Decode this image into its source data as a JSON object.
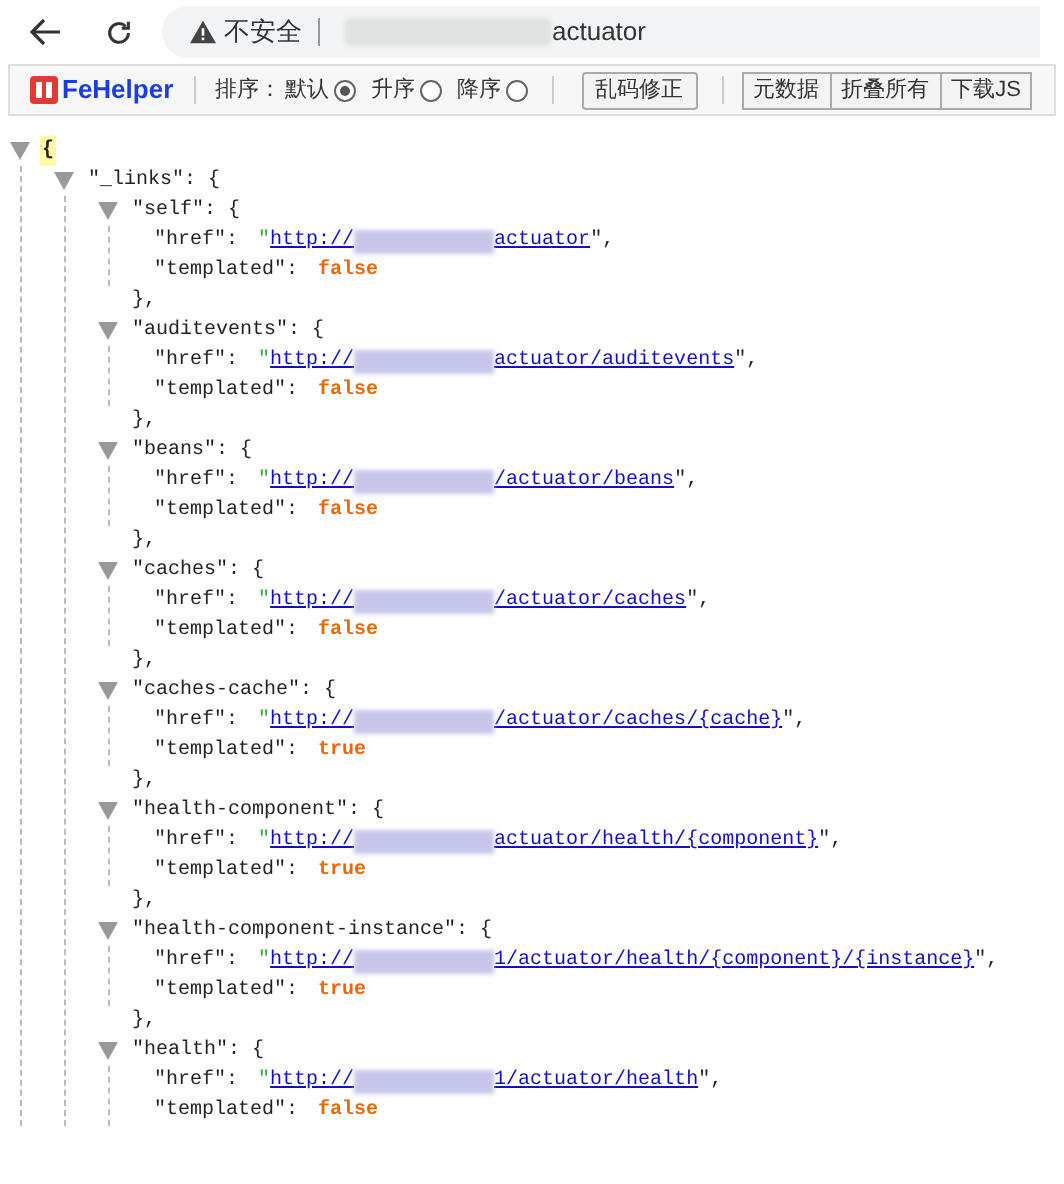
{
  "browser": {
    "security_label": "不安全",
    "url_suffix": "actuator"
  },
  "fehelper": {
    "name": "FeHelper",
    "sort_label": "排序：",
    "sort_options": [
      {
        "label": "默认",
        "selected": true
      },
      {
        "label": "升序",
        "selected": false
      },
      {
        "label": "降序",
        "selected": false
      }
    ],
    "buttons": [
      "乱码修正"
    ],
    "group_buttons": [
      "元数据",
      "折叠所有",
      "下载JS"
    ]
  },
  "tree": {
    "open": "{",
    "expanded": true,
    "children": [
      {
        "label": "\"_links\":  {",
        "expanded": true,
        "children": [
          {
            "label": "\"self\":  {",
            "expanded": true,
            "close": "},",
            "fields": [
              {
                "kind": "link",
                "key": "\"href\":",
                "quote": "\"",
                "prefix": "http://",
                "suffix": "actuator",
                "trail": "\","
              },
              {
                "kind": "bool",
                "key": "\"templated\":",
                "value": "false"
              }
            ]
          },
          {
            "label": "\"auditevents\":  {",
            "expanded": true,
            "close": "},",
            "fields": [
              {
                "kind": "link",
                "key": "\"href\":",
                "quote": "\"",
                "prefix": "http://",
                "suffix": "actuator/auditevents",
                "trail": "\","
              },
              {
                "kind": "bool",
                "key": "\"templated\":",
                "value": "false"
              }
            ]
          },
          {
            "label": "\"beans\":  {",
            "expanded": true,
            "close": "},",
            "fields": [
              {
                "kind": "link",
                "key": "\"href\":",
                "quote": "\"",
                "prefix": "http://",
                "suffix": "/actuator/beans",
                "trail": "\","
              },
              {
                "kind": "bool",
                "key": "\"templated\":",
                "value": "false"
              }
            ]
          },
          {
            "label": "\"caches\":  {",
            "expanded": true,
            "close": "},",
            "fields": [
              {
                "kind": "link",
                "key": "\"href\":",
                "quote": "\"",
                "prefix": "http://",
                "suffix": "/actuator/caches",
                "trail": "\","
              },
              {
                "kind": "bool",
                "key": "\"templated\":",
                "value": "false"
              }
            ]
          },
          {
            "label": "\"caches-cache\":  {",
            "expanded": true,
            "close": "},",
            "fields": [
              {
                "kind": "link",
                "key": "\"href\":",
                "quote": "\"",
                "prefix": "http://",
                "suffix": "/actuator/caches/{cache}",
                "trail": "\","
              },
              {
                "kind": "bool",
                "key": "\"templated\":",
                "value": "true"
              }
            ]
          },
          {
            "label": "\"health-component\":  {",
            "expanded": true,
            "close": "},",
            "fields": [
              {
                "kind": "link",
                "key": "\"href\":",
                "quote": "\"",
                "prefix": "http://",
                "suffix": "actuator/health/{component}",
                "trail": "\","
              },
              {
                "kind": "bool",
                "key": "\"templated\":",
                "value": "true"
              }
            ]
          },
          {
            "label": "\"health-component-instance\":  {",
            "expanded": true,
            "close": "},",
            "fields": [
              {
                "kind": "link",
                "key": "\"href\":",
                "quote": "\"",
                "prefix": "http://",
                "suffix": "1/actuator/health/{component}/{instance}",
                "trail": "\","
              },
              {
                "kind": "bool",
                "key": "\"templated\":",
                "value": "true"
              }
            ]
          },
          {
            "label": "\"health\":  {",
            "expanded": true,
            "fields": [
              {
                "kind": "link",
                "key": "\"href\":",
                "quote": "\"",
                "prefix": "http://",
                "suffix": "1/actuator/health",
                "trail": "\","
              },
              {
                "kind": "bool",
                "key": "\"templated\":",
                "value": "false"
              }
            ]
          }
        ]
      }
    ]
  }
}
